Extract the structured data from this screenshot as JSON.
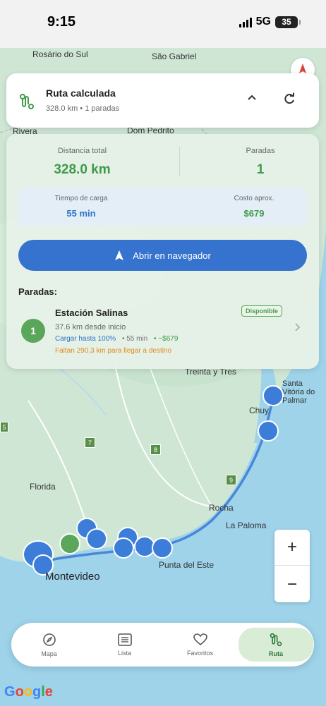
{
  "status": {
    "time": "9:15",
    "network": "5G",
    "battery": "35"
  },
  "map": {
    "places": [
      "Rosário do Sul",
      "São Gabriel",
      "Rivera",
      "Dom Pedrito",
      "Treinta y Tres",
      "Santa Vitória do Palmar",
      "Chuy",
      "Florida",
      "Rocha",
      "La Paloma",
      "Punta del Este",
      "Montevideo"
    ],
    "route_numbers": [
      "7",
      "8",
      "9",
      "5"
    ]
  },
  "route_card": {
    "title": "Ruta calculada",
    "subtitle": "328.0 km • 1 paradas"
  },
  "summary": {
    "distance_label": "Distancia total",
    "distance_value": "328.0 km",
    "stops_label": "Paradas",
    "stops_value": "1",
    "charge_time_label": "Tiempo de carga",
    "charge_time_value": "55 min",
    "cost_label": "Costo aprox.",
    "cost_value": "$679"
  },
  "open_button_label": "Abrir en navegador",
  "stops_header": "Paradas:",
  "stops": [
    {
      "number": "1",
      "name": "Estación Salinas",
      "badge": "Disponible",
      "distance": "37.6 km desde inicio",
      "charge": "Cargar hasta 100%",
      "time": "• 55 min",
      "cost": "• ~$679",
      "warning": "Faltan 290.3 km para llegar a destino"
    }
  ],
  "nav": {
    "items": [
      {
        "label": "Mapa",
        "icon": "compass-icon"
      },
      {
        "label": "Lista",
        "icon": "list-icon"
      },
      {
        "label": "Favoritos",
        "icon": "heart-icon"
      },
      {
        "label": "Ruta",
        "icon": "route-icon"
      }
    ],
    "active": "Ruta"
  },
  "colors": {
    "accent_green": "#3f9a4a",
    "accent_blue": "#3673cf",
    "warning": "#e08a1e"
  },
  "google_logo": "Google"
}
